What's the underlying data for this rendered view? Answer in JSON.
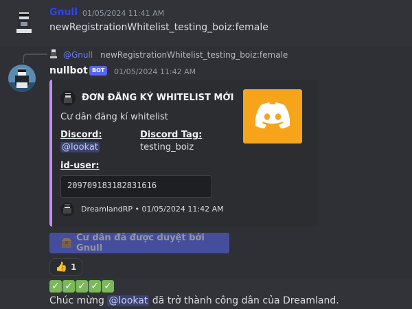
{
  "msg1": {
    "author": "Gnull",
    "timestamp": "01/05/2024 11:41 AM",
    "content": "newRegistrationWhitelist_testing_boiz:female"
  },
  "reply": {
    "mention": "@Gnull",
    "content": "newRegistrationWhitelist_testing_boiz:female"
  },
  "msg2": {
    "author": "nullbot",
    "bot_tag": "BOT",
    "timestamp": "01/05/2024 11:42 AM",
    "embed": {
      "title": "ĐƠN ĐĂNG KÝ WHITELIST MỚI",
      "description": "Cư dân đăng kí whitelist",
      "field1_name": "Discord:",
      "field1_value": "@lookat",
      "field2_name": "Discord Tag:",
      "field2_value": "testing_boiz",
      "field3_name": "id-user:",
      "field3_value": "209709183182831616",
      "footer_text": "DreamlandRP • 01/05/2024 11:42 AM",
      "accent_color": "#c38df3",
      "thumbnail_bg": "#f6a51b"
    },
    "button_label": "Cư dân đã được duyệt bởi Gnull",
    "reaction_emoji": "👍",
    "reaction_count": "1"
  },
  "msg3": {
    "checkmarks": [
      "✓",
      "✓",
      "✓",
      "✓",
      "✓"
    ],
    "content_before": "Chúc mừng ",
    "mention": "@lookat",
    "content_after": " đã trở thành công dân của Dreamland."
  },
  "colors": {
    "gnull_name": "#2f43f5",
    "nullbot_name": "#f2f3f5",
    "blurple": "#5865f2"
  }
}
